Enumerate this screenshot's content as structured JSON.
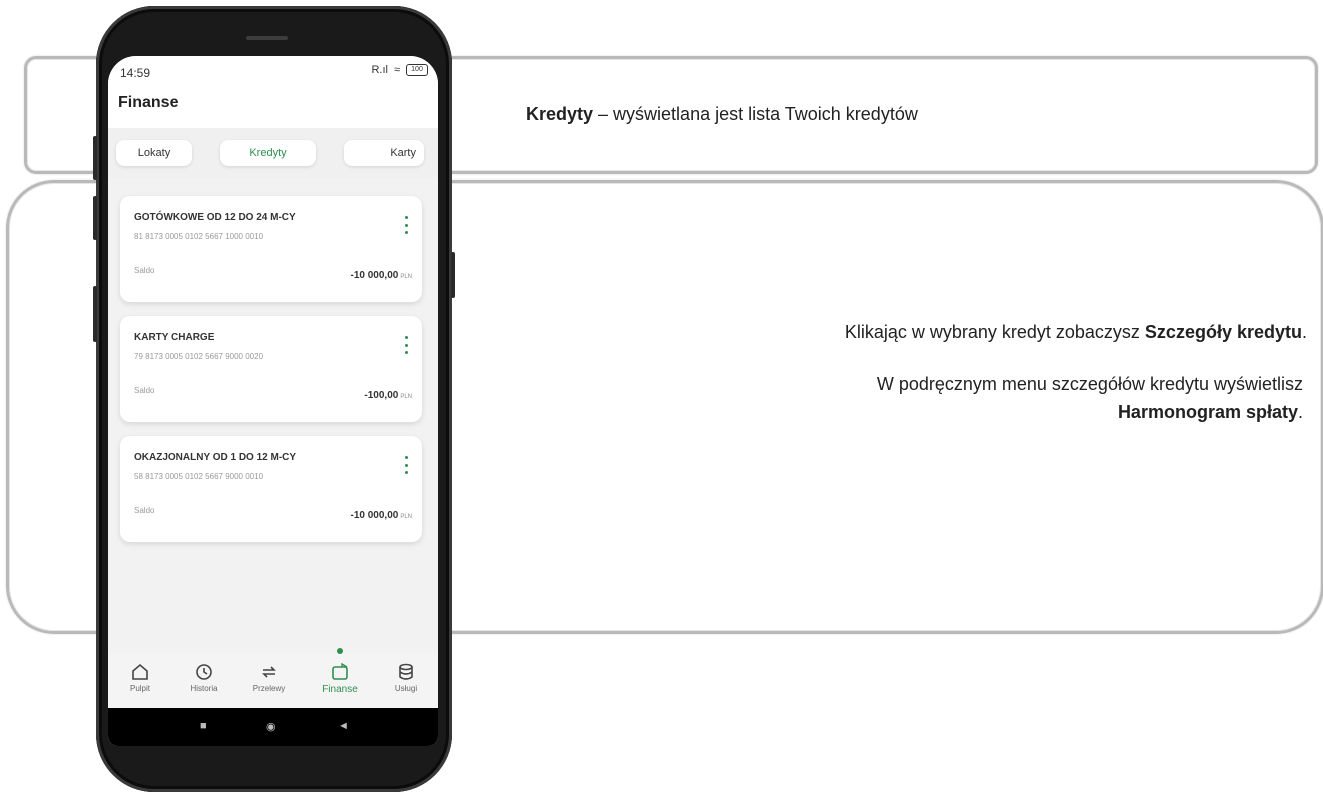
{
  "phone": {
    "status": {
      "time": "14:59",
      "signal": "R.ıl",
      "wifi": "≈",
      "battery": "100"
    },
    "title": "Finanse",
    "tabs": [
      {
        "label": "Lokaty"
      },
      {
        "label": "Kredyty"
      },
      {
        "label": "Karty"
      }
    ],
    "cards": [
      {
        "name": "GOTÓWKOWE OD 12 DO 24 M-CY",
        "account": "81 8173 0005 0102 5667 1000 0010",
        "saldo_label": "Saldo",
        "amount": "-10 000,00",
        "currency": "PLN"
      },
      {
        "name": "KARTY CHARGE",
        "account": "79 8173 0005 0102 5667 9000 0020",
        "saldo_label": "Saldo",
        "amount": "-100,00",
        "currency": "PLN"
      },
      {
        "name": "OKAZJONALNY OD 1 DO 12 M-CY",
        "account": "58 8173 0005 0102 5667 9000 0010",
        "saldo_label": "Saldo",
        "amount": "-10 000,00",
        "currency": "PLN"
      }
    ],
    "nav": [
      {
        "label": "Pulpit",
        "icon": "home-icon"
      },
      {
        "label": "Historia",
        "icon": "history-icon"
      },
      {
        "label": "Przelewy",
        "icon": "transfer-icon"
      },
      {
        "label": "Finanse",
        "icon": "wallet-icon",
        "active": true
      },
      {
        "label": "Usługi",
        "icon": "database-icon"
      }
    ],
    "system_buttons": {
      "recent": "■",
      "home": "◉",
      "back": "◄"
    }
  },
  "description": {
    "line1_bold": "Kredyty",
    "line1_rest": " – wyświetlana jest lista Twoich kredytów",
    "line2_text": "Klikając w wybrany  kredyt  zobaczysz ",
    "line2_bold": "Szczegóły kredytu",
    "line2_end": ".",
    "line3_text": "W podręcznym  menu szczegółów kredytu  wyświetlisz",
    "line4_bold": "Harmonogram spłaty",
    "line4_end": "."
  },
  "colors": {
    "accent": "#2f8f4e",
    "frame": "#b9b9b9"
  }
}
